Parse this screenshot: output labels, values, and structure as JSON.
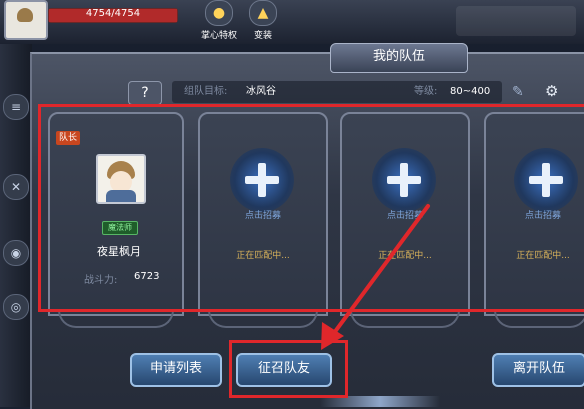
{
  "hud": {
    "hp_text": "4754/4754",
    "hp_fraction": 1.0,
    "icons": [
      {
        "icon": "penguin-icon",
        "label": "掌心特权"
      },
      {
        "icon": "shirt-icon",
        "label": "变装"
      }
    ]
  },
  "panel": {
    "title": "我的队伍",
    "help_label": "?",
    "team_goal_label": "组队目标:",
    "team_goal_value": "冰风谷",
    "level_label": "等级:",
    "level_value": "80~400"
  },
  "captain": {
    "tag": "队长",
    "class_badge": "魔法师",
    "name": "夜星枫月",
    "power_label": "战斗力:",
    "power_value": "6723"
  },
  "slots": [
    {
      "recruit_label": "点击招募",
      "status": "正在匹配中..."
    },
    {
      "recruit_label": "点击招募",
      "status": "正在匹配中..."
    },
    {
      "recruit_label": "点击招募",
      "status": "正在匹配中..."
    }
  ],
  "buttons": {
    "apply_list": "申请列表",
    "recruit": "征召队友",
    "leave": "离开队伍"
  },
  "annotation_color": "#e0272b",
  "accent": "#4f7fb3"
}
